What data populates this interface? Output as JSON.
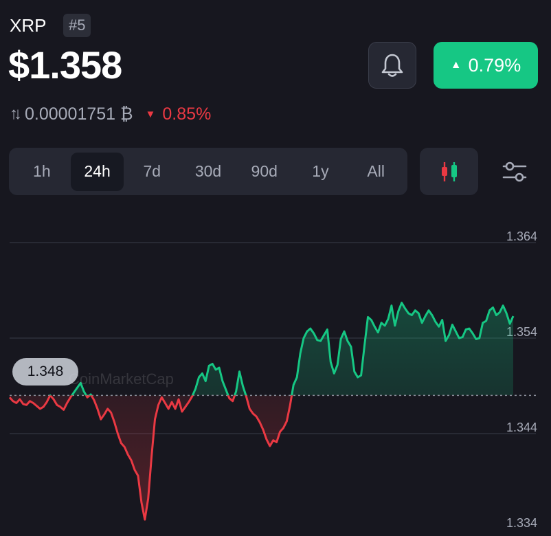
{
  "coin": {
    "symbol": "XRP",
    "rank": "#5",
    "price": "$1.358",
    "change_24h": "0.79%",
    "btc_price": "0.00001751 ₿",
    "btc_change": "0.85%"
  },
  "colors": {
    "up": "#16c784",
    "down": "#ea3943",
    "background": "#17171f",
    "panel": "#262833"
  },
  "icons": {
    "alert": "bell-icon",
    "up_arrow": "triangle-up-icon",
    "down_arrow": "triangle-down-icon",
    "swap": "swap-vertical-icon",
    "candles": "candlestick-icon",
    "filters": "sliders-icon"
  },
  "timeframes": {
    "items": [
      "1h",
      "24h",
      "7d",
      "30d",
      "90d",
      "1y",
      "All"
    ],
    "selected": "24h"
  },
  "chart": {
    "y_labels": [
      "1.364",
      "1.354",
      "1.344",
      "1.334"
    ],
    "reference_label": "1.348",
    "watermark": "CoinMarketCap"
  },
  "chart_data": {
    "type": "line",
    "x_range": "24h",
    "ylim": [
      1.334,
      1.364
    ],
    "reference_value": 1.348,
    "values": [
      1.3478,
      1.3474,
      1.3472,
      1.3476,
      1.3471,
      1.347,
      1.3474,
      1.3472,
      1.3469,
      1.3466,
      1.3468,
      1.3473,
      1.348,
      1.3476,
      1.347,
      1.3468,
      1.3465,
      1.3472,
      1.3478,
      1.3483,
      1.3488,
      1.3493,
      1.3484,
      1.3478,
      1.3481,
      1.3475,
      1.3466,
      1.3455,
      1.346,
      1.3466,
      1.3462,
      1.3452,
      1.344,
      1.343,
      1.3426,
      1.3418,
      1.3412,
      1.3402,
      1.3396,
      1.3368,
      1.335,
      1.3372,
      1.3416,
      1.3455,
      1.347,
      1.3478,
      1.3472,
      1.3466,
      1.3473,
      1.3466,
      1.3476,
      1.3463,
      1.3468,
      1.3473,
      1.3479,
      1.3487,
      1.3499,
      1.3503,
      1.3495,
      1.3511,
      1.3513,
      1.3507,
      1.3509,
      1.3495,
      1.3486,
      1.3477,
      1.3474,
      1.3484,
      1.3505,
      1.349,
      1.3479,
      1.3466,
      1.3461,
      1.3458,
      1.3452,
      1.3444,
      1.3434,
      1.3427,
      1.3433,
      1.3431,
      1.3442,
      1.3446,
      1.3453,
      1.347,
      1.3491,
      1.3499,
      1.3524,
      1.354,
      1.3547,
      1.355,
      1.3545,
      1.3538,
      1.3537,
      1.3543,
      1.3549,
      1.3515,
      1.3503,
      1.3512,
      1.3539,
      1.3547,
      1.3537,
      1.3531,
      1.3505,
      1.3499,
      1.3501,
      1.3532,
      1.3562,
      1.3559,
      1.3552,
      1.3546,
      1.3556,
      1.3553,
      1.356,
      1.3574,
      1.3553,
      1.3568,
      1.3577,
      1.3571,
      1.3566,
      1.3564,
      1.3569,
      1.3566,
      1.3556,
      1.3563,
      1.3569,
      1.3564,
      1.3557,
      1.3552,
      1.3559,
      1.3537,
      1.3543,
      1.3554,
      1.3547,
      1.354,
      1.3541,
      1.3549,
      1.355,
      1.3545,
      1.3539,
      1.354,
      1.3556,
      1.3558,
      1.3569,
      1.3572,
      1.3564,
      1.3567,
      1.3574,
      1.3566,
      1.3555,
      1.3563
    ]
  }
}
